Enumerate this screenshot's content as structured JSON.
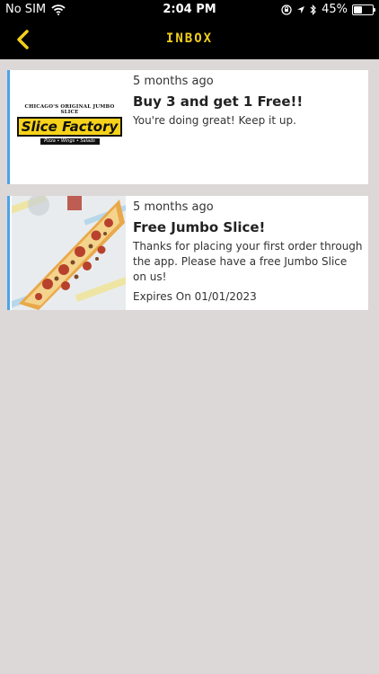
{
  "status_bar": {
    "carrier": "No SIM",
    "time": "2:04 PM",
    "battery": "45%",
    "battery_level": 0.45
  },
  "nav": {
    "title": "INBOX",
    "accent_color": "#f2cf1c"
  },
  "messages": [
    {
      "ago": "5 months ago",
      "title": "Buy 3 and get 1 Free!!",
      "body": "You're doing great! Keep it up.",
      "logo": {
        "tagline": "CHICAGO'S ORIGINAL JUMBO SLICE",
        "name": "Slice Factory",
        "sub": "Pizza • Wings • Salads"
      }
    },
    {
      "ago": "5 months ago",
      "title": "Free Jumbo Slice!",
      "body": "Thanks for placing your first order through the app. Please have a free Jumbo Slice on us!",
      "expires": "Expires On 01/01/2023"
    }
  ],
  "colors": {
    "card_accent": "#4aa3ea",
    "background": "#dcd8d7"
  }
}
